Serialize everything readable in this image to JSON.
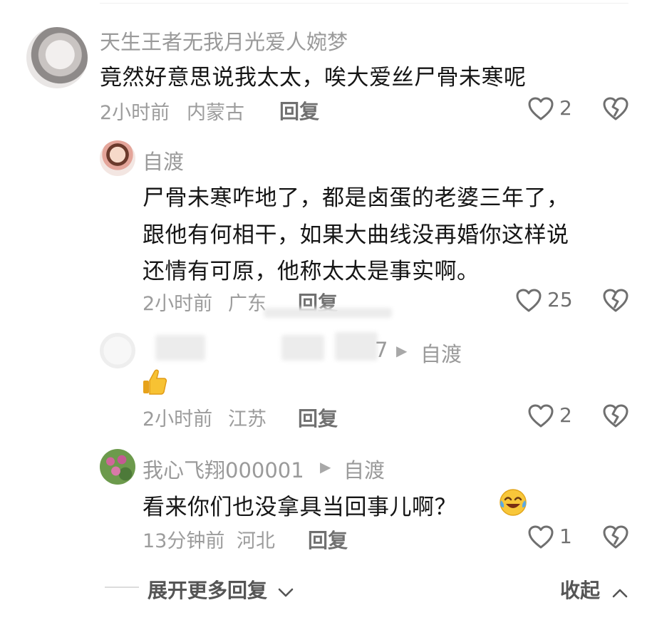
{
  "comments": [
    {
      "username": "天生王者无我月光爱人婉梦",
      "text": "竟然好意思说我太太，唉大爱丝尸骨未寒呢",
      "time": "2小时前",
      "location": "内蒙古",
      "reply_label": "回复",
      "likes": "2"
    },
    {
      "username": "自渡",
      "text_lines": [
        "尸骨未寒咋地了，都是卤蛋的老婆三年了，",
        "跟他有何相干，如果大曲线没再婚你这样说",
        "还情有可原，他称太太是事实啊。"
      ],
      "time": "2小时前",
      "location": "广东",
      "reply_label": "回复",
      "likes": "25"
    },
    {
      "username_partial": "7",
      "reply_to": "自渡",
      "time": "2小时前",
      "location": "江苏",
      "reply_label": "回复",
      "likes": "2"
    },
    {
      "username": "我心飞翔000001",
      "reply_to": "自渡",
      "text": "看来你们也没拿具当回事儿啊？",
      "time": "13分钟前",
      "location": "河北",
      "reply_label": "回复",
      "likes": "1"
    }
  ],
  "footer": {
    "expand_label": "展开更多回复",
    "collapse_label": "收起"
  },
  "icons": {
    "like": "heart-outline-icon",
    "dislike": "broken-heart-icon",
    "reply_arrow": "play-arrow-icon",
    "thumb_emoji": "thumbs-up-emoji",
    "laugh_emoji": "crying-laughing-emoji"
  },
  "colors": {
    "text": "#151515",
    "muted": "#9c9c9c",
    "action": "#707070"
  }
}
